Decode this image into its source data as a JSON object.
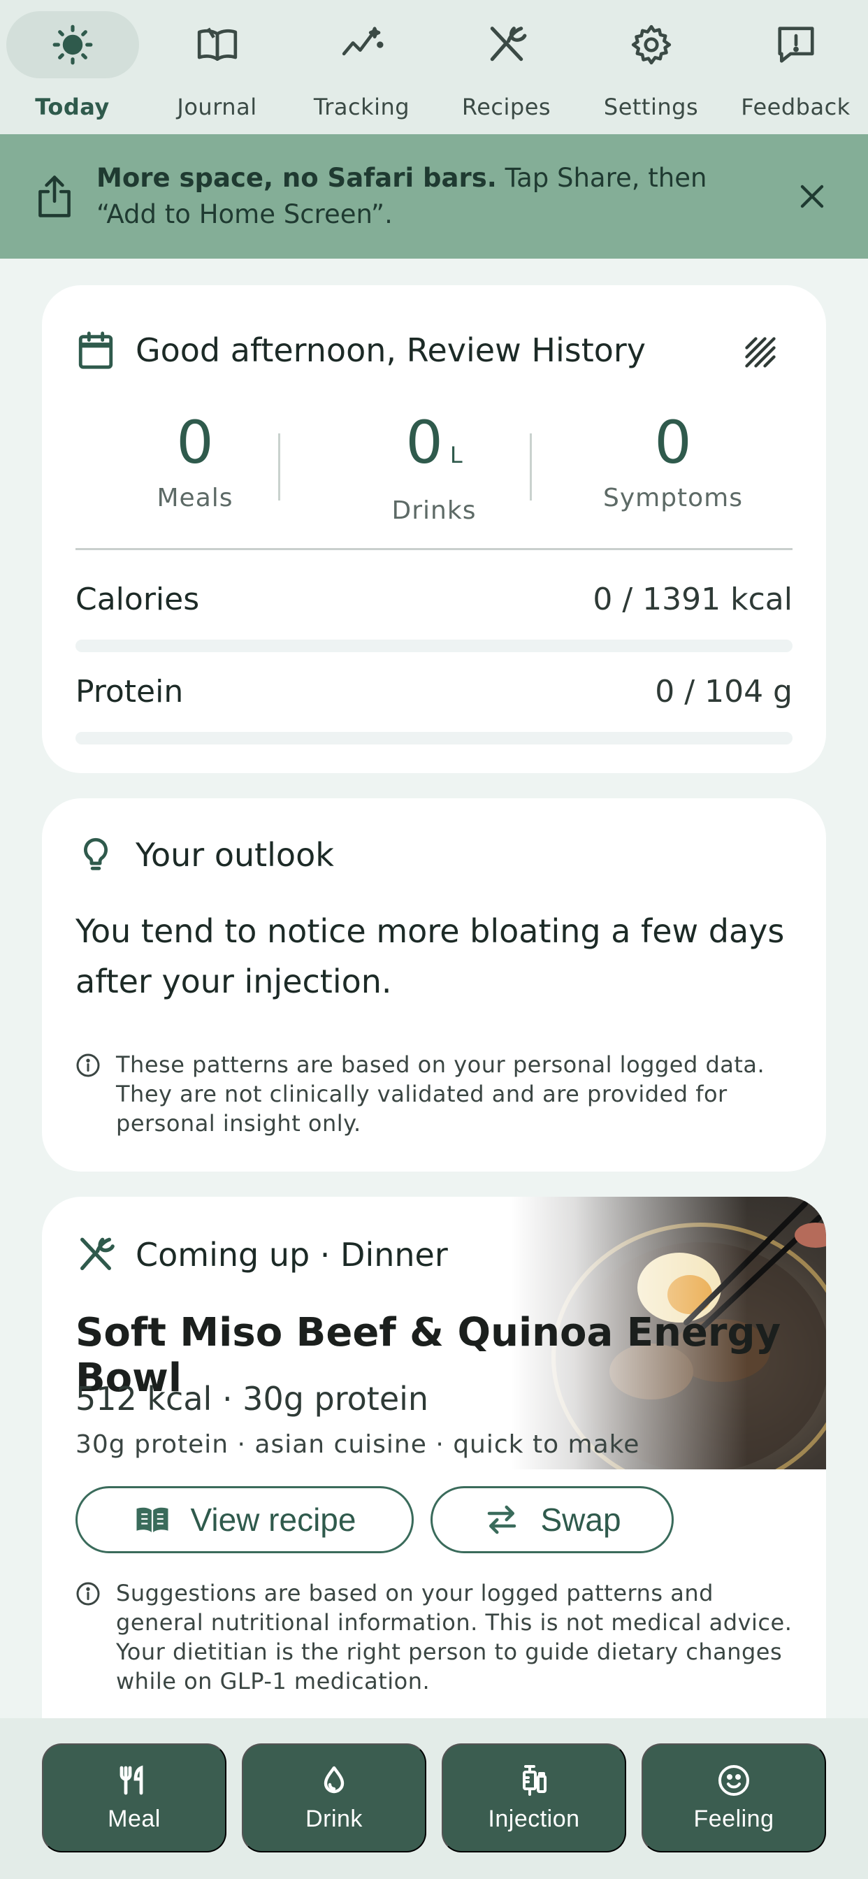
{
  "nav": {
    "items": [
      {
        "label": "Today",
        "icon": "sun-icon",
        "active": true
      },
      {
        "label": "Journal",
        "icon": "book-icon",
        "active": false
      },
      {
        "label": "Tracking",
        "icon": "trend-sparkle-icon",
        "active": false
      },
      {
        "label": "Recipes",
        "icon": "fork-spoon-icon",
        "active": false
      },
      {
        "label": "Settings",
        "icon": "gear-icon",
        "active": false
      },
      {
        "label": "Feedback",
        "icon": "feedback-icon",
        "active": false
      }
    ]
  },
  "banner": {
    "bold": "More space, no Safari bars.",
    "rest": " Tap Share, then “Add to Home Screen”."
  },
  "summary": {
    "greeting": "Good afternoon, Review History",
    "stats": [
      {
        "value": "0",
        "unit": "",
        "label": "Meals"
      },
      {
        "value": "0",
        "unit": "L",
        "label": "Drinks"
      },
      {
        "value": "0",
        "unit": "",
        "label": "Symptoms"
      }
    ],
    "calories": {
      "label": "Calories",
      "value": "0 / 1391 kcal",
      "progress": 0
    },
    "protein": {
      "label": "Protein",
      "value": "0 / 104 g",
      "progress": 0
    }
  },
  "outlook": {
    "title": "Your outlook",
    "text": "You tend to notice more bloating a few days after your injection.",
    "note": "These patterns are based on your personal logged data. They are not clinically validated and are provided for personal insight only."
  },
  "dinner": {
    "heading": "Coming up · Dinner",
    "title": "Soft Miso Beef & Quinoa Energy Bowl",
    "kcal": "512 kcal · 30g protein",
    "tags": "30g protein · asian cuisine · quick to make",
    "view_label": "View recipe",
    "swap_label": "Swap",
    "note": "Suggestions are based on your logged patterns and general nutritional information. This is not medical advice. Your dietitian is the right person to guide dietary changes while on GLP-1 medication."
  },
  "actions": [
    {
      "label": "Meal",
      "icon": "utensils-icon"
    },
    {
      "label": "Drink",
      "icon": "droplet-icon"
    },
    {
      "label": "Injection",
      "icon": "syringe-icon"
    },
    {
      "label": "Feeling",
      "icon": "smile-icon"
    }
  ],
  "colors": {
    "primary": "#2f5a4c",
    "banner": "#84ae97",
    "action": "#3b5d50",
    "background": "#eef4f2"
  }
}
